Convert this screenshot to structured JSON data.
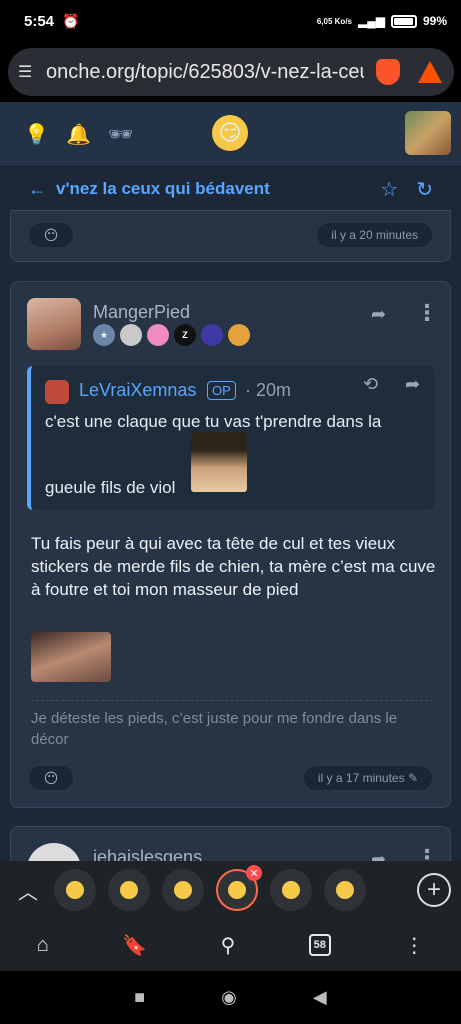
{
  "status": {
    "time": "5:54",
    "speed": "6,05 Ko/s",
    "battery": "99%"
  },
  "browser": {
    "url": "onche.org/topic/625803/v-nez-la-ceux"
  },
  "header": {
    "title": "v'nez la ceux qui bédavent"
  },
  "prev_post": {
    "timestamp": "il y a 20 minutes"
  },
  "post": {
    "author": "MangerPied",
    "quote": {
      "author": "LeVraiXemnas",
      "op_label": "OP",
      "time": "· 20m",
      "line1": "c'est une claque que tu vas t'prendre dans la",
      "line2": "gueule fils de viol"
    },
    "body": "Tu fais peur à qui avec ta tête de cul et tes vieux stickers de merde fils de chien, ta mère c’est ma cuve à foutre et toi mon masseur de pied",
    "signature": "Je déteste les pieds, c’est juste pour me fondre dans le décor",
    "timestamp": "il y a 17 minutes"
  },
  "next_post": {
    "author": "jehaislesgens"
  },
  "tabs": {
    "count": "58"
  }
}
